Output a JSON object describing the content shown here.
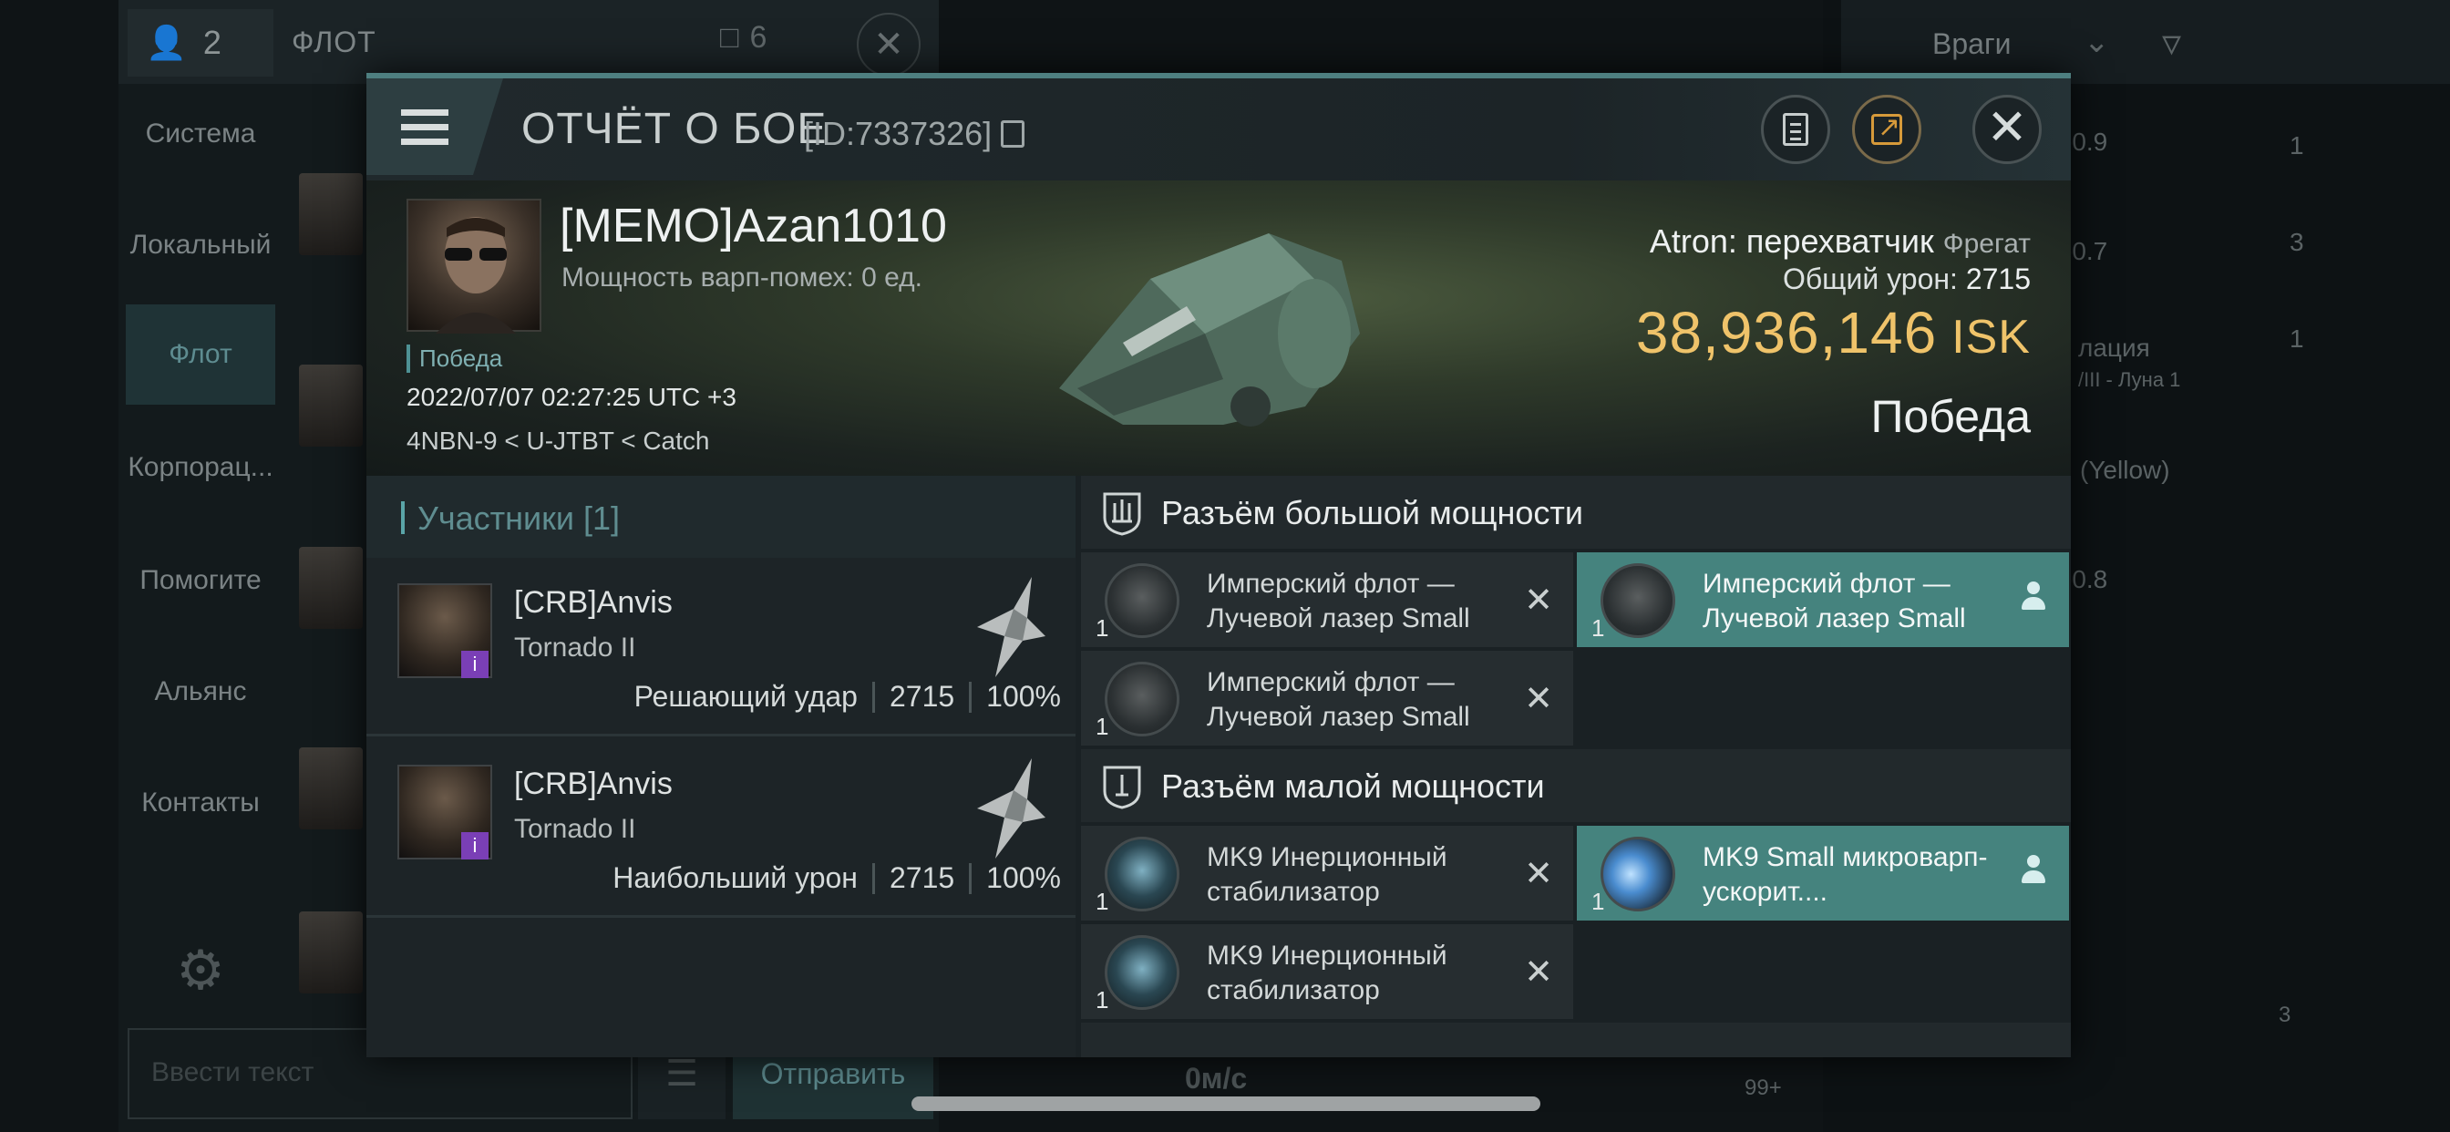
{
  "background": {
    "chat": {
      "member_count": "2",
      "channel_title": "ФЛОТ",
      "message_count": "6",
      "channels": [
        "Система",
        "Локальный",
        "Флот",
        "Корпорац...",
        "Помогите",
        "Альянс",
        "Контакты"
      ],
      "active_channel": "Флот",
      "input_placeholder": "Ввести текст",
      "send_label": "Отправить"
    },
    "overview": {
      "filter_label": "Враги",
      "speed": "0м/с",
      "items": [
        "-0.9",
        "-0.7",
        "лация",
        "/III - Луна 1",
        "(Yellow)",
        "-0.8"
      ],
      "counts": [
        "1",
        "3",
        "1"
      ],
      "drone_badge": "99+",
      "cargo_badge": "3"
    }
  },
  "report": {
    "title": "ОТЧЁТ О БОЕ",
    "id": "[ID:7337326]",
    "victim": {
      "name": "[MEMO]Azan1010",
      "warp_jam": "Мощность варп-помех: 0 ед.",
      "result_tag": "Победа",
      "datetime": "2022/07/07 02:27:25 UTC +3",
      "location": "4NBN-9 < U-JTBT < Catch",
      "ship_name": "Atron: перехватчик",
      "ship_class": "Фрегат",
      "total_damage_label": "Общий урон:",
      "total_damage": "2715",
      "isk_value": "38,936,146",
      "isk_unit": "ISK",
      "result": "Победа"
    },
    "participants": {
      "title": "Участники [1]",
      "rows": [
        {
          "name": "[CRB]Anvis",
          "ship": "Tornado II",
          "role": "Решающий удар",
          "damage": "2715",
          "percent": "100%",
          "badge": "i"
        },
        {
          "name": "[CRB]Anvis",
          "ship": "Tornado II",
          "role": "Наибольший урон",
          "damage": "2715",
          "percent": "100%",
          "badge": "i"
        }
      ]
    },
    "fittings": {
      "high_slot_title": "Разъём большой мощности",
      "high_slots": [
        {
          "name": "Имперский флот — Лучевой лазер Small",
          "qty": "1",
          "state": "destroyed"
        },
        {
          "name": "Имперский флот — Лучевой лазер Small",
          "qty": "1",
          "state": "dropped"
        },
        {
          "name": "Имперский флот — Лучевой лазер Small",
          "qty": "1",
          "state": "destroyed"
        }
      ],
      "low_slot_title": "Разъём малой мощности",
      "low_slots": [
        {
          "name": "MK9 Инерционный стабилизатор",
          "qty": "1",
          "state": "destroyed"
        },
        {
          "name": "MK9 Small микроварп-ускорит....",
          "qty": "1",
          "state": "dropped"
        },
        {
          "name": "MK9 Инерционный стабилизатор",
          "qty": "1",
          "state": "destroyed"
        }
      ]
    }
  }
}
